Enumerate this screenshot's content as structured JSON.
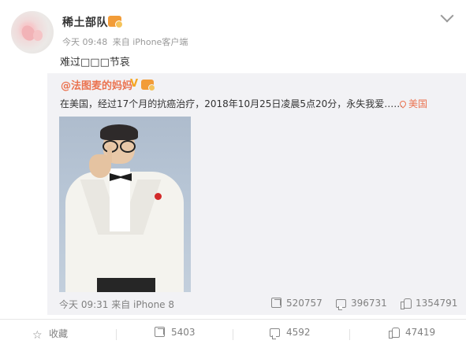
{
  "post": {
    "username": "稀土部队",
    "time": "今天 09:48",
    "source": "来自 iPhone客户端",
    "text": "难过□□□节哀"
  },
  "repost": {
    "author": "@法图麦的妈妈",
    "verified_mark": "V",
    "text": "在美国，经过17个月的抗癌治疗，2018年10月25日凌晨5点20分，永失我爱……",
    "location": "美国",
    "time": "今天 09:31",
    "source": "来自 iPhone 8",
    "reposts": "520757",
    "comments": "396731",
    "likes": "1354791"
  },
  "actions": {
    "favorite": "收藏",
    "repost_count": "5403",
    "comment_count": "4592",
    "like_count": "47419"
  },
  "icons": {
    "more": "chevron-down-icon",
    "badge": "vip-badge-icon",
    "location": "location-pin-icon",
    "share": "repost-icon",
    "comment": "comment-icon",
    "like": "thumbs-up-icon",
    "favorite": "star-icon"
  },
  "colors": {
    "link": "#eb7350",
    "repost_bg": "#f2f2f5",
    "meta": "#999999",
    "badge": "#f29c38"
  }
}
